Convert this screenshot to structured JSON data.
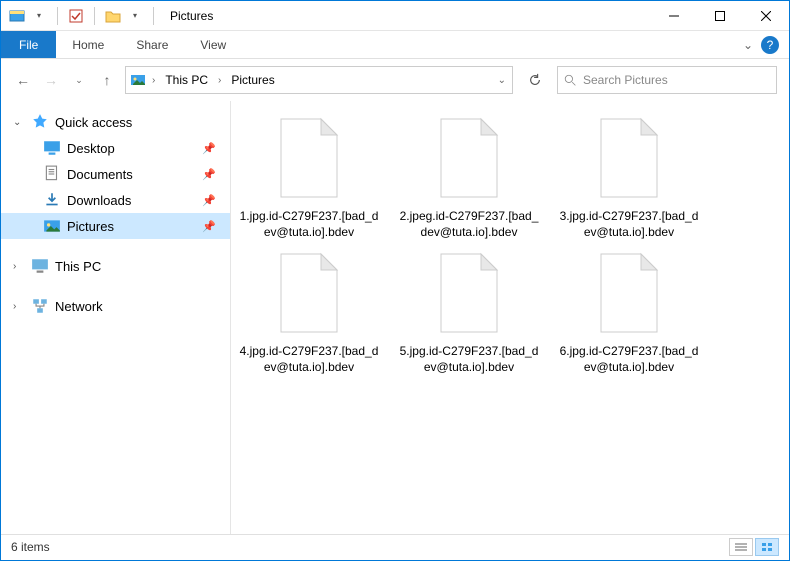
{
  "window": {
    "title": "Pictures"
  },
  "ribbon": {
    "file": "File",
    "tabs": [
      "Home",
      "Share",
      "View"
    ]
  },
  "breadcrumb": {
    "root": "This PC",
    "current": "Pictures"
  },
  "search": {
    "placeholder": "Search Pictures"
  },
  "sidebar": {
    "quick_access": "Quick access",
    "items": [
      {
        "label": "Desktop",
        "pinned": true
      },
      {
        "label": "Documents",
        "pinned": true
      },
      {
        "label": "Downloads",
        "pinned": true
      },
      {
        "label": "Pictures",
        "pinned": true,
        "selected": true
      }
    ],
    "this_pc": "This PC",
    "network": "Network"
  },
  "files": [
    {
      "name": "1.jpg.id-C279F237.[bad_dev@tuta.io].bdev"
    },
    {
      "name": "2.jpeg.id-C279F237.[bad_dev@tuta.io].bdev"
    },
    {
      "name": "3.jpg.id-C279F237.[bad_dev@tuta.io].bdev"
    },
    {
      "name": "4.jpg.id-C279F237.[bad_dev@tuta.io].bdev"
    },
    {
      "name": "5.jpg.id-C279F237.[bad_dev@tuta.io].bdev"
    },
    {
      "name": "6.jpg.id-C279F237.[bad_dev@tuta.io].bdev"
    }
  ],
  "status": {
    "count_text": "6 items"
  }
}
